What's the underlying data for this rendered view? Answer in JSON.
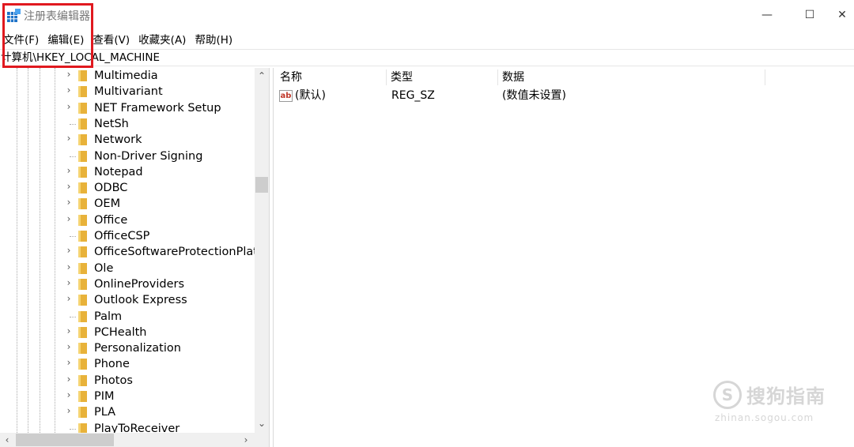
{
  "window": {
    "title": "注册表编辑器",
    "minimize_glyph": "—",
    "maximize_glyph": "☐",
    "close_glyph": "✕"
  },
  "menu": [
    "文件(F)",
    "编辑(E)",
    "查看(V)",
    "收藏夹(A)",
    "帮助(H)"
  ],
  "address": "计算机\\HKEY_LOCAL_MACHINE",
  "tree": [
    {
      "label": "Multimedia",
      "expandable": true
    },
    {
      "label": "Multivariant",
      "expandable": true
    },
    {
      "label": "NET Framework Setup",
      "expandable": true
    },
    {
      "label": "NetSh",
      "expandable": false
    },
    {
      "label": "Network",
      "expandable": true
    },
    {
      "label": "Non-Driver Signing",
      "expandable": false
    },
    {
      "label": "Notepad",
      "expandable": true
    },
    {
      "label": "ODBC",
      "expandable": true
    },
    {
      "label": "OEM",
      "expandable": true
    },
    {
      "label": "Office",
      "expandable": true
    },
    {
      "label": "OfficeCSP",
      "expandable": false
    },
    {
      "label": "OfficeSoftwareProtectionPlatfo",
      "expandable": true
    },
    {
      "label": "Ole",
      "expandable": true
    },
    {
      "label": "OnlineProviders",
      "expandable": true
    },
    {
      "label": "Outlook Express",
      "expandable": true
    },
    {
      "label": "Palm",
      "expandable": false
    },
    {
      "label": "PCHealth",
      "expandable": true
    },
    {
      "label": "Personalization",
      "expandable": true
    },
    {
      "label": "Phone",
      "expandable": true
    },
    {
      "label": "Photos",
      "expandable": true
    },
    {
      "label": "PIM",
      "expandable": true
    },
    {
      "label": "PLA",
      "expandable": true
    },
    {
      "label": "PlayToReceiver",
      "expandable": false
    }
  ],
  "list": {
    "columns": [
      "名称",
      "类型",
      "数据"
    ],
    "rows": [
      {
        "name": "(默认)",
        "type": "REG_SZ",
        "data": "(数值未设置)"
      }
    ]
  },
  "watermark": {
    "logo_glyph": "S",
    "text": "搜狗指南",
    "url": "zhinan.sogou.com"
  },
  "icons": {
    "expand": "›",
    "scroll_up": "⌃",
    "scroll_down": "⌄",
    "scroll_left": "‹",
    "scroll_right": "›",
    "value_type_badge": "ab"
  },
  "colors": {
    "highlight_box": "#e0191f",
    "folder": "#e8b23a",
    "title_text": "#777777"
  }
}
